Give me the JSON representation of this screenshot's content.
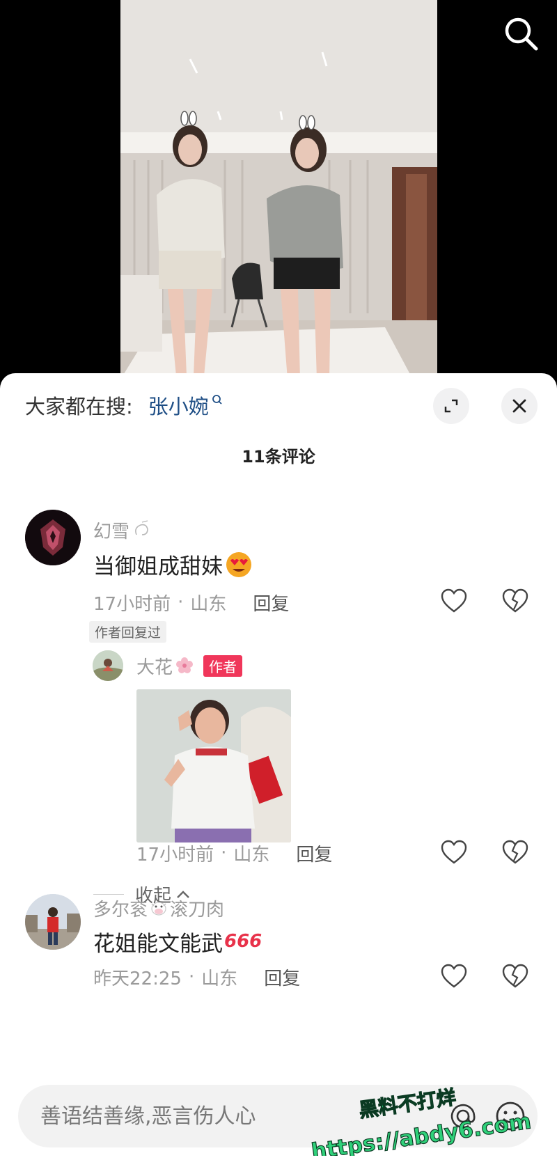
{
  "sheet": {
    "trending_label": "大家都在搜:",
    "trending_term": "张小婉",
    "comment_count": "11条评论",
    "input_placeholder": "善语结善缘,恶言伤人心"
  },
  "comments": [
    {
      "username": "幻雪",
      "text": "当御姐成甜妹",
      "time": "17小时前",
      "location": "山东",
      "reply_label": "回复",
      "tag": "作者回复过",
      "replies": [
        {
          "username": "大花",
          "badge": "作者",
          "time": "17小时前",
          "location": "山东",
          "reply_label": "回复"
        }
      ],
      "collapse_label": "收起"
    },
    {
      "username_a": "多尔衮",
      "username_b": "滚刀肉",
      "text": "花姐能文能武",
      "emoji_text": "666",
      "time": "昨天22:25",
      "location": "山东",
      "reply_label": "回复"
    }
  ],
  "watermark": {
    "line1": "黑料不打烊",
    "line2": "https://abdy6.com"
  },
  "colors": {
    "sheet_bg": "#ffffff",
    "trending_term": "#1f4f86",
    "author_badge": "#f0365a",
    "watermark": "#2fd17a"
  },
  "icons": [
    "search-icon",
    "expand-icon",
    "close-icon",
    "heart-icon",
    "broken-heart-icon",
    "chevron-up-icon",
    "at-icon",
    "emoji-icon"
  ]
}
